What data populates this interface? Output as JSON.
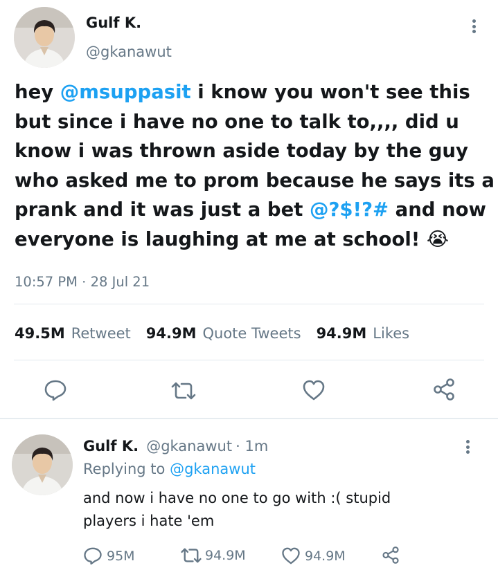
{
  "tweet": {
    "author_name": "Gulf K.",
    "author_handle": "@gkanawut",
    "text_lines": [
      {
        "pre": "hey ",
        "mention": "@msuppasit",
        "post": " i know you won't see this"
      },
      {
        "pre": "but since i have no one to talk to,,,, did u",
        "mention": "",
        "post": ""
      },
      {
        "pre": "know i was thrown aside today by the guy",
        "mention": "",
        "post": ""
      },
      {
        "pre": "who asked me to prom because he says its a",
        "mention": "",
        "post": ""
      },
      {
        "pre": "prank and it was just a bet ",
        "mention": "@?$!?#",
        "post": " and now"
      },
      {
        "pre": "everyone is laughing at me at school! ",
        "mention": "",
        "post": ""
      }
    ],
    "emoji": "😭",
    "timestamp": "10:57 PM · 28 Jul 21",
    "stats": {
      "retweets_count": "49.5M",
      "retweets_label": "Retweet",
      "quotes_count": "94.9M",
      "quotes_label": "Quote Tweets",
      "likes_count": "94.9M",
      "likes_label": "Likes"
    }
  },
  "reply": {
    "author_name": "Gulf K.",
    "author_handle": "@gkanawut",
    "time_ago": "· 1m",
    "replying_prefix": "Replying to",
    "replying_to": "@gkanawut",
    "text_lines": [
      "and now i have no one to go with :( stupid",
      "players i hate 'em"
    ],
    "reply_count": "95M",
    "retweet_count": "94.9M",
    "like_count": "94.9M"
  },
  "colors": {
    "accent": "#1da1f2",
    "secondary_text": "#657786",
    "primary_text": "#14171a",
    "divider": "#e1e8ed"
  },
  "icons": [
    "avatar",
    "more-vertical-icon",
    "reply-icon",
    "retweet-icon",
    "like-icon",
    "share-icon"
  ]
}
